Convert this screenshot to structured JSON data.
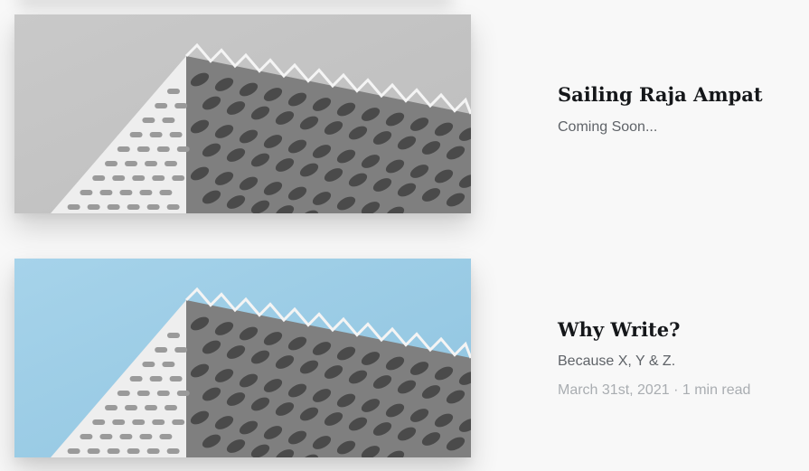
{
  "posts": [
    {
      "title": "Sailing Raja Ampat",
      "excerpt": "Coming Soon...",
      "sky_color": "#c9c9c9",
      "sky_color_dark": "#bdbdbd"
    },
    {
      "title": "Why Write?",
      "excerpt": "Because X, Y & Z.",
      "date": "March 31st, 2021",
      "separator": "·",
      "read_time": "1 min read",
      "sky_color": "#a6d3ea",
      "sky_color_dark": "#8fc4e0"
    }
  ]
}
